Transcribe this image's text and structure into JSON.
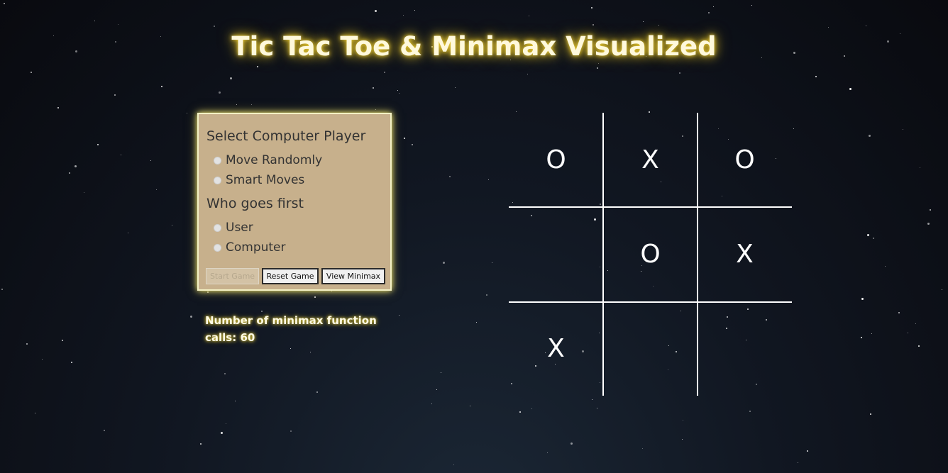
{
  "title": "Tic Tac Toe & Minimax Visualized",
  "panel": {
    "computer_player_heading": "Select Computer Player",
    "computer_player_options": [
      "Move Randomly",
      "Smart Moves"
    ],
    "first_heading": "Who goes first",
    "first_options": [
      "User",
      "Computer"
    ],
    "buttons": {
      "start": "Start Game",
      "reset": "Reset Game",
      "view": "View Minimax"
    }
  },
  "minimax_calls_text": "Number of minimax function calls: 60",
  "board": {
    "cells": [
      "O",
      "X",
      "O",
      "",
      "O",
      "X",
      "X",
      "",
      ""
    ]
  },
  "colors": {
    "panel_background": "#c7b08c",
    "title_glow": "#f2d23a",
    "grid_lines": "#ffffff"
  }
}
